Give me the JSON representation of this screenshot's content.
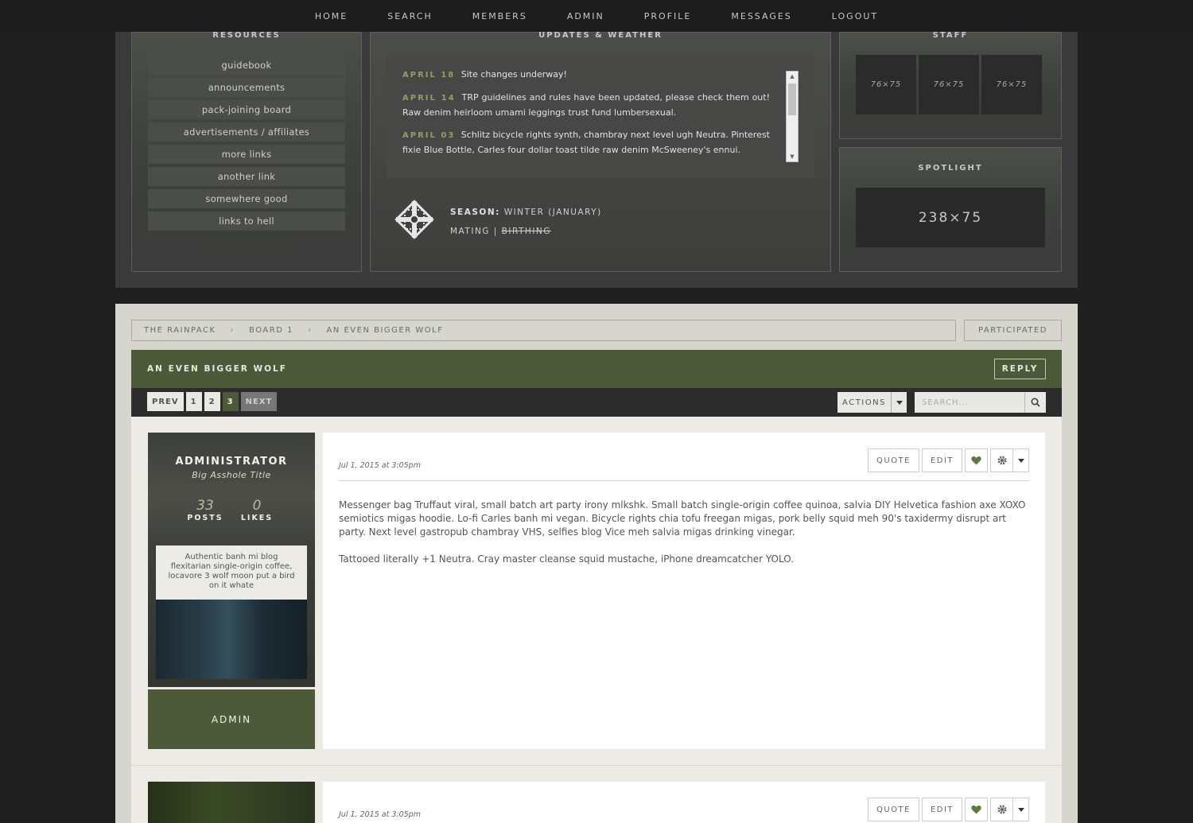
{
  "nav": [
    "HOME",
    "SEARCH",
    "MEMBERS",
    "ADMIN",
    "PROFILE",
    "MESSAGES",
    "LOGOUT"
  ],
  "resources": {
    "title": "RESOURCES",
    "links": [
      "guidebook",
      "announcements",
      "pack-joining board",
      "advertisements / affiliates",
      "more links",
      "another link",
      "somewhere good",
      "links to hell"
    ]
  },
  "updates": {
    "title": "UPDATES & WEATHER",
    "items": [
      {
        "date": "APRIL 18",
        "text": "Site changes underway!"
      },
      {
        "date": "APRIL 14",
        "text": "TRP guidelines and rules have been updated, please check them out! Raw denim heirloom umami leggings trust fund lumbersexual."
      },
      {
        "date": "APRIL 03",
        "text": "Schlitz bicycle rights synth, chambray next level ugh Neutra. Pinterest fixie Blue Bottle, Carles four dollar toast tilde raw denim McSweeney's ennui."
      }
    ],
    "season_label": "SEASON:",
    "season_value": "WINTER (JANUARY)",
    "mating": "MATING",
    "divider": "|",
    "birthing": "BIRTHING",
    "season_icon": "snowflake-icon"
  },
  "staff": {
    "title": "STAFF",
    "slots": [
      "76×75",
      "76×75",
      "76×75"
    ]
  },
  "spotlight": {
    "title": "SPOTLIGHT",
    "placeholder": "238×75"
  },
  "breadcrumb": [
    "THE RAINPACK",
    "BOARD 1",
    "AN EVEN BIGGER WOLF"
  ],
  "breadcrumb_sep": "›",
  "participated_label": "PARTICIPATED",
  "thread": {
    "title": "AN EVEN BIGGER WOLF",
    "reply_label": "REPLY"
  },
  "pagination": {
    "prev": "PREV",
    "pages": [
      "1",
      "2",
      "3"
    ],
    "current": "3",
    "next": "NEXT"
  },
  "actions_label": "ACTIONS",
  "search_placeholder": "SEARCH...",
  "posts": [
    {
      "username": "ADMINISTRATOR",
      "user_title": "Big Asshole Title",
      "posts_count": "33",
      "posts_label": "POSTS",
      "likes_count": "0",
      "likes_label": "LIKES",
      "bio": "Authentic banh mi blog flexitarian single-origin coffee, locavore 3 wolf moon put a bird on it whate",
      "rank": "ADMIN",
      "date": "Jul 1, 2015 at 3:05pm",
      "quote_label": "QUOTE",
      "edit_label": "EDIT",
      "paragraphs": [
        "Messenger bag Truffaut viral, small batch art party irony mlkshk. Small batch single-origin coffee quinoa, salvia DIY Helvetica fashion axe XOXO semiotics migas hoodie. Lo-fi Carles banh mi vegan. Bicycle rights chia tofu freegan migas, pork belly squid meh 90's taxidermy disrupt art party. Next level gastropub chambray VHS, selfies blog Vice meh salvia migas drinking vinegar.",
        "Tattooed literally +1 Neutra. Cray master cleanse squid mustache, iPhone dreamcatcher YOLO."
      ]
    },
    {
      "date": "Jul 1, 2015 at 3:05pm",
      "quote_label": "QUOTE",
      "edit_label": "EDIT"
    }
  ],
  "colors": {
    "accent": "#4d5a3a",
    "date_green": "#8f9e6d",
    "like_green": "#5f7a3e"
  }
}
